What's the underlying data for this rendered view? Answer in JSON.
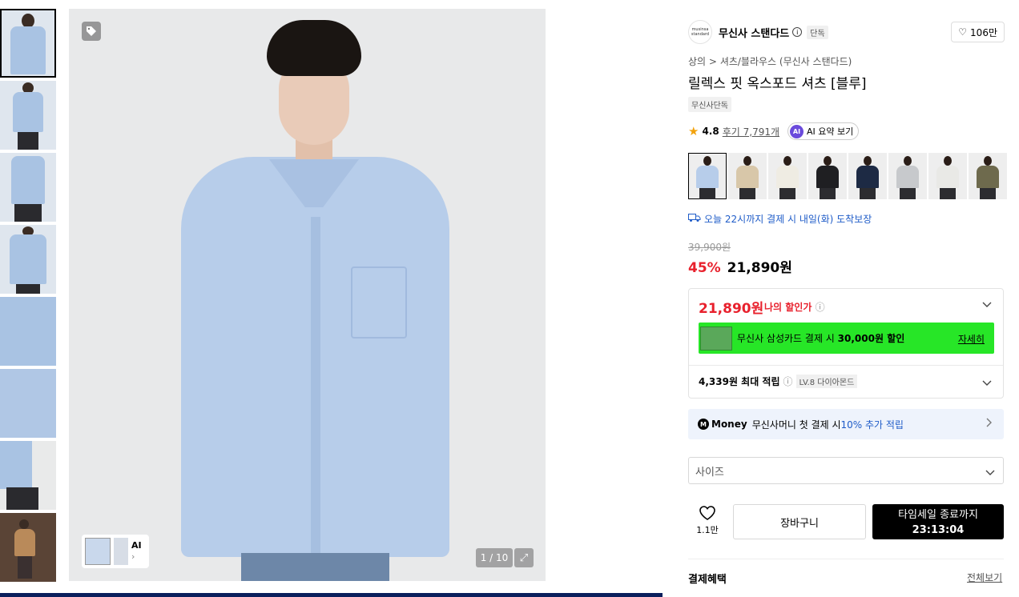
{
  "gallery": {
    "counter": "1 / 10",
    "ai_chip_label": "AI",
    "ai_chip_arrow": "›"
  },
  "brand": {
    "logo_text": "musinsa standard",
    "name": "무신사 스탠다드",
    "badge": "단독",
    "likes": "106만"
  },
  "product": {
    "breadcrumb_1": "상의",
    "breadcrumb_sep": ">",
    "breadcrumb_2": "셔츠/블라우스 (무신사 스탠다드)",
    "title": "릴렉스 핏 옥스포드 셔츠 [블루]",
    "exclusive_tag": "무신사단독",
    "rating": "4.8",
    "reviews": "후기 7,791개",
    "ai_summary": "AI 요약 보기"
  },
  "color_swatches": [
    "#b7cdea",
    "#d8c7a9",
    "#efece3",
    "#1f1f22",
    "#1d2a44",
    "#c7c9cc",
    "#e9e9e6",
    "#6e6a4d"
  ],
  "delivery": "오늘 22시까지 결제 시 내일(화) 도착보장",
  "pricing": {
    "original": "39,900원",
    "discount_rate": "45%",
    "sale_price": "21,890원",
    "my_price": "21,890원",
    "my_price_label": "나의 할인가",
    "card_promo_prefix": "무신사 삼성카드 결제 시 ",
    "card_promo_amount": "30,000원 할인",
    "card_promo_more": "자세히",
    "points": "4,339원 최대 적립",
    "level_badge": "LV.8 다이아몬드"
  },
  "money_banner": {
    "logo": "M",
    "brand": "Money",
    "text": "무신사머니 첫 결제 시 ",
    "highlight": "10% 추가 적립"
  },
  "size_select": {
    "placeholder": "사이즈"
  },
  "actions": {
    "wish_count": "1.1만",
    "cart": "장바구니",
    "sale_label": "타임세일 종료까지",
    "sale_timer": "23:13:04"
  },
  "payment": {
    "title": "결제혜택",
    "more": "전체보기"
  },
  "colors": {
    "discount_red": "#e8212d",
    "link_blue": "#1f5cc8",
    "promo_green": "#27e627",
    "dark": "#000000"
  }
}
